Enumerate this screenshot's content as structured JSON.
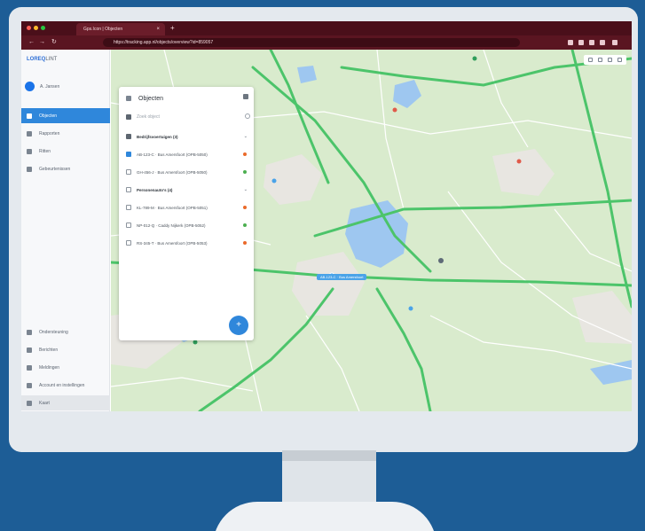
{
  "browser": {
    "tab_title": "Gps.Icon | Objecten",
    "new_tab_symbol": "+",
    "tab_close_symbol": "×",
    "url": "https://tracking.app.nl/objects/overview?id=859057",
    "back_symbol": "←",
    "forward_symbol": "→",
    "reload_symbol": "↻",
    "window_dot_colors": [
      "#ff5f57",
      "#febc2e",
      "#28c840"
    ]
  },
  "sidebar": {
    "logo_prefix": "LOREQ",
    "logo_suffix": "LINT",
    "user_name": "A. Jansen",
    "items": [
      {
        "label": "Objecten",
        "icon": "pin-icon",
        "active": true
      },
      {
        "label": "Rapporten",
        "icon": "report-icon",
        "active": false
      },
      {
        "label": "Ritten",
        "icon": "route-icon",
        "active": false
      },
      {
        "label": "Gebeurtenissen",
        "icon": "event-icon",
        "active": false
      }
    ],
    "bottom_items": [
      {
        "label": "Ondersteuning",
        "icon": "help-icon"
      },
      {
        "label": "Berichten",
        "icon": "message-icon"
      },
      {
        "label": "Meldingen",
        "icon": "bell-icon"
      },
      {
        "label": "Account en instellingen",
        "icon": "settings-icon"
      },
      {
        "label": "Kaart",
        "icon": "map-icon"
      }
    ]
  },
  "panel": {
    "title": "Objecten",
    "search_placeholder": "Zoek object",
    "rows": [
      {
        "label": "Bedrijfsvoertuigen (3)",
        "type": "group",
        "check": "mixed",
        "status": ""
      },
      {
        "label": "AB-123-C · Bus Amersfoort (OPB-5050)",
        "type": "item",
        "check": "checked",
        "status": "#ea6a2a"
      },
      {
        "label": "GH-456-J · Bus Amersfoort (OPB-5050)",
        "type": "item",
        "check": "none",
        "status": "#4caf50"
      },
      {
        "label": "Personenauto's (4)",
        "type": "group",
        "check": "none",
        "status": ""
      },
      {
        "label": "KL-789-M · Bus Amersfoort (OPB-5051)",
        "type": "item",
        "check": "none",
        "status": "#ea6a2a"
      },
      {
        "label": "NP-012-Q · Caddy Nijkerk (OPB-5052)",
        "type": "item",
        "check": "none",
        "status": "#4caf50"
      },
      {
        "label": "RS-345-T · Bus Amersfoort (OPB-5053)",
        "type": "item",
        "check": "none",
        "status": "#ea6a2a"
      }
    ],
    "fab_symbol": "+"
  },
  "map": {
    "selected_object_label": "AB-123-C · Bus Amersfoort",
    "colors": {
      "land": "#d9ebcd",
      "water": "#9ec7f0",
      "highway": "#4cc46a",
      "road": "#ffffff",
      "urban": "#e8e6e1"
    }
  }
}
